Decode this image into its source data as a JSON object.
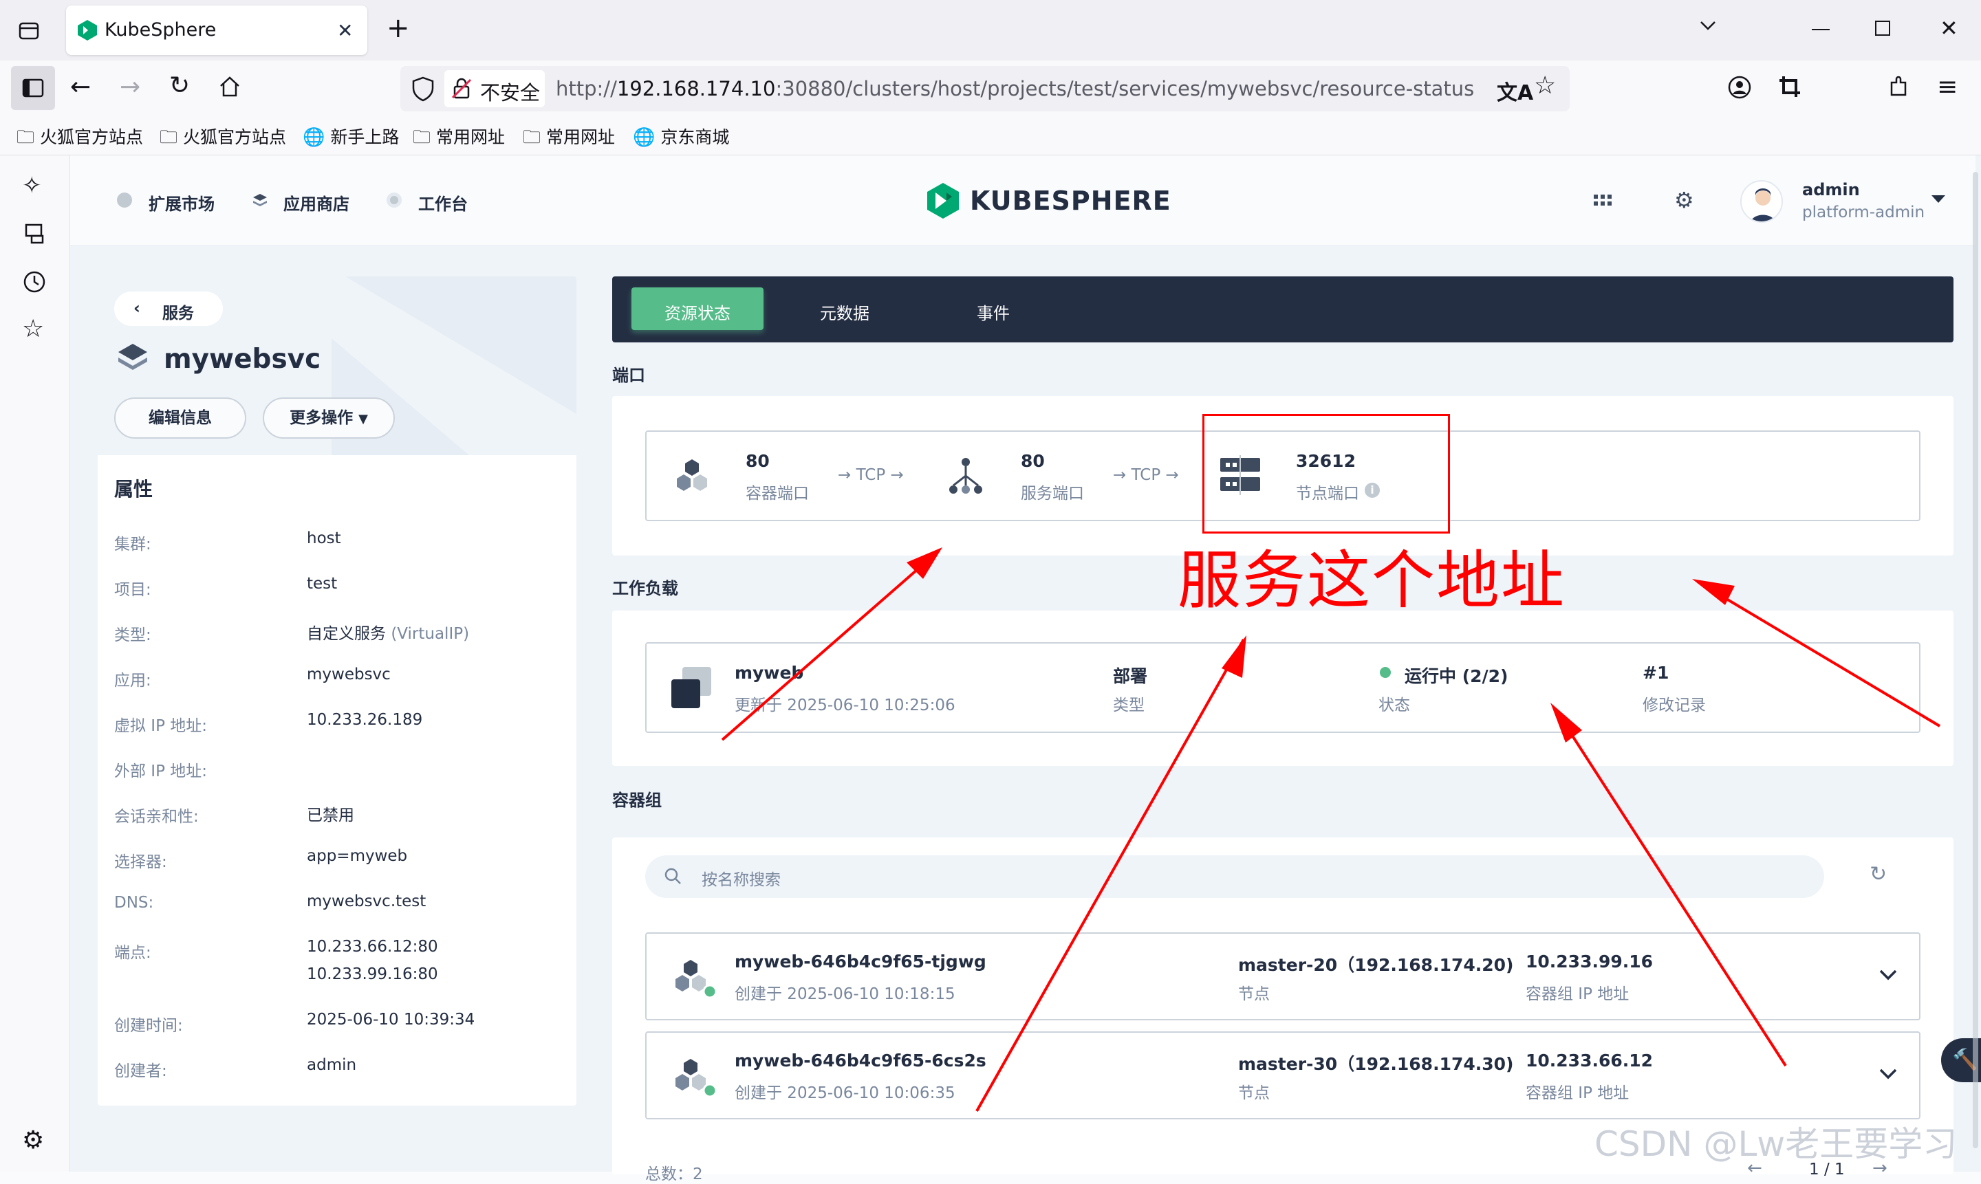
{
  "browser": {
    "tab_title": "KubeSphere",
    "security_label": "不安全",
    "url_prefix": "http://",
    "url_host": "192.168.174.10",
    "url_rest": ":30880/clusters/host/projects/test/services/mywebsvc/resource-status",
    "bookmarks": [
      "火狐官方站点",
      "火狐官方站点",
      "新手上路",
      "常用网址",
      "常用网址",
      "京东商城"
    ]
  },
  "topnav": {
    "items": [
      "扩展市场",
      "应用商店",
      "工作台"
    ],
    "logo_text": "KUBESPHERE",
    "user_name": "admin",
    "user_role": "platform-admin"
  },
  "service": {
    "back_label": "服务",
    "name": "mywebsvc",
    "edit_button": "编辑信息",
    "more_button": "更多操作",
    "props_title": "属性",
    "props": [
      {
        "k": "集群:",
        "v": "host"
      },
      {
        "k": "项目:",
        "v": "test"
      },
      {
        "k": "类型:",
        "v": "自定义服务",
        "v2": "(VirtualIP)"
      },
      {
        "k": "应用:",
        "v": "mywebsvc"
      },
      {
        "k": "虚拟 IP 地址:",
        "v": "10.233.26.189"
      },
      {
        "k": "外部 IP 地址:",
        "v": ""
      },
      {
        "k": "会话亲和性:",
        "v": "已禁用"
      },
      {
        "k": "选择器:",
        "v": "app=myweb"
      },
      {
        "k": "DNS:",
        "v": "mywebsvc.test"
      },
      {
        "k": "端点:",
        "v": "10.233.66.12:80",
        "v3": "10.233.99.16:80"
      },
      {
        "k": "创建时间:",
        "v": "2025-06-10 10:39:34"
      },
      {
        "k": "创建者:",
        "v": "admin"
      }
    ]
  },
  "tabs": [
    "资源状态",
    "元数据",
    "事件"
  ],
  "ports": {
    "title": "端口",
    "container_port": "80",
    "container_port_label": "容器端口",
    "protocol1": "→ TCP →",
    "service_port": "80",
    "service_port_label": "服务端口",
    "protocol2": "→ TCP →",
    "node_port": "32612",
    "node_port_label": "节点端口"
  },
  "workload": {
    "title": "工作负载",
    "name": "myweb",
    "updated": "更新于 2025-06-10 10:25:06",
    "type": "部署",
    "type_label": "类型",
    "status": "运行中 (2/2)",
    "status_label": "状态",
    "revision": "#1",
    "revision_label": "修改记录"
  },
  "pods": {
    "title": "容器组",
    "search_placeholder": "按名称搜索",
    "items": [
      {
        "name": "myweb-646b4c9f65-tjgwg",
        "created": "创建于 2025-06-10 10:18:15",
        "node": "master-20（192.168.174.20)",
        "node_label": "节点",
        "ip": "10.233.99.16",
        "ip_label": "容器组 IP 地址"
      },
      {
        "name": "myweb-646b4c9f65-6cs2s",
        "created": "创建于 2025-06-10 10:06:35",
        "node": "master-30（192.168.174.30)",
        "node_label": "节点",
        "ip": "10.233.66.12",
        "ip_label": "容器组 IP 地址"
      }
    ],
    "total": "总数：2",
    "pagination": "1 / 1"
  },
  "annotation": {
    "text": "服务这个地址",
    "color": "#ff0000"
  },
  "watermark": "CSDN @Lw老王要学习",
  "colors": {
    "accent": "#55bc8a",
    "dark": "#242e42",
    "muted": "#79879c"
  }
}
